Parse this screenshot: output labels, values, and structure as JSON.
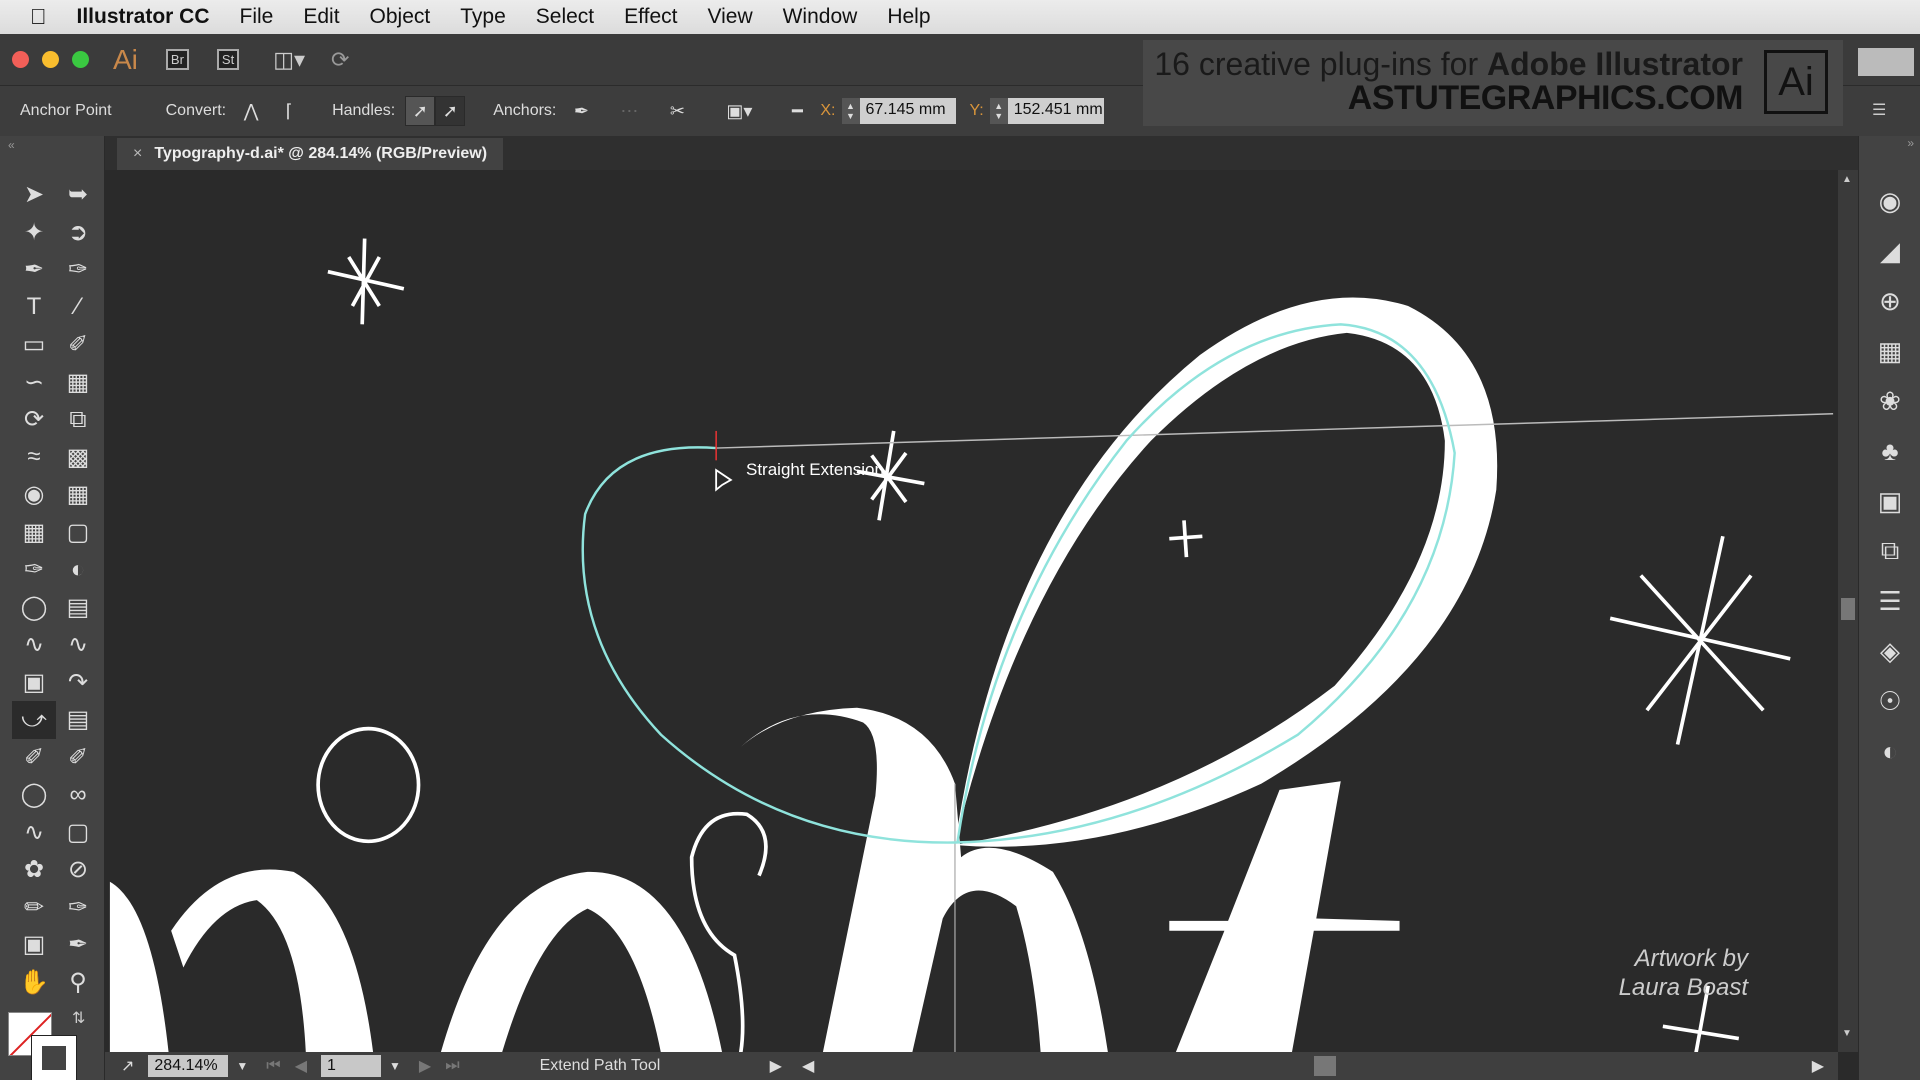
{
  "menubar": {
    "apple": "",
    "app": "Illustrator CC",
    "items": [
      "File",
      "Edit",
      "Object",
      "Type",
      "Select",
      "Effect",
      "View",
      "Window",
      "Help"
    ]
  },
  "appbar": {
    "logo": "Ai",
    "bridge": "Br",
    "stock": "St"
  },
  "control": {
    "tool_name": "Anchor Point",
    "convert_label": "Convert:",
    "handles_label": "Handles:",
    "anchors_label": "Anchors:",
    "x_label": "X:",
    "x_value": "67.145 mm",
    "y_label": "Y:",
    "y_value": "152.451 mm"
  },
  "ad": {
    "line1_light": "16 creative plug-ins for ",
    "line1_bold": "Adobe Illustrator",
    "line2": "ASTUTEGRAPHICS.COM",
    "logo": "Ai"
  },
  "document": {
    "tab_title": "Typography-d.ai* @ 284.14% (RGB/Preview)",
    "close": "×"
  },
  "canvas": {
    "tooltip": "Straight Extension",
    "credit_line1": "Artwork by",
    "credit_line2": "Laura Boast"
  },
  "status": {
    "zoom": "284.14%",
    "page": "1",
    "tool": "Extend Path Tool"
  },
  "colors": {
    "path": "#8fe3dc",
    "artwork": "#ffffff",
    "background": "#2a2a2a"
  }
}
